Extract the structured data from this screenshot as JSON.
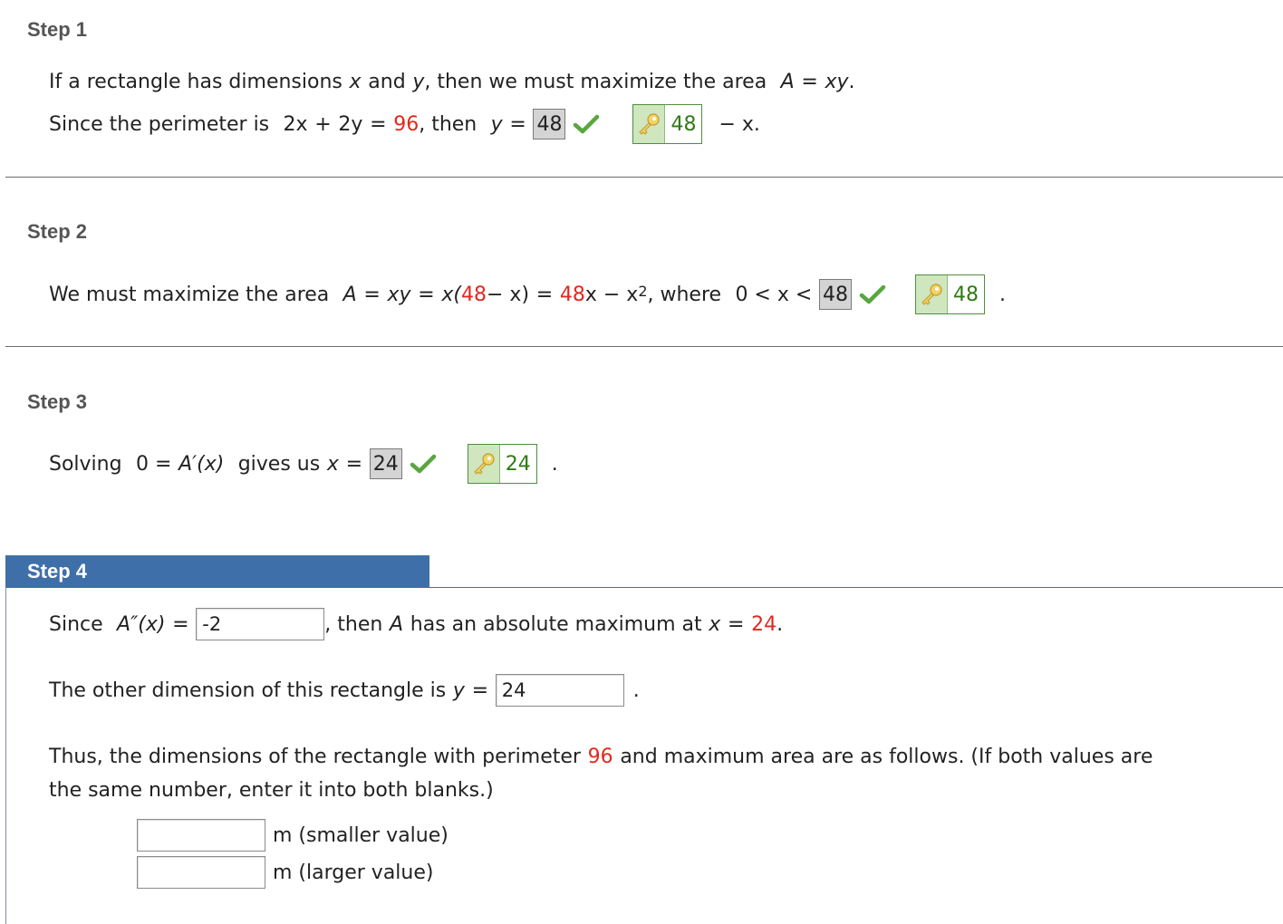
{
  "step1": {
    "title": "Step 1",
    "line1_a": "If a rectangle has dimensions",
    "line1_x": "x",
    "line1_and": "and",
    "line1_y": "y",
    "line1_b": ", then we must maximize the area",
    "line1_A": "A",
    "line1_eq": "=",
    "line1_xy": "xy",
    "line1_end": ".",
    "line2_a": "Since the perimeter is",
    "line2_2x": "2x",
    "line2_plus": "+",
    "line2_2y": "2y",
    "line2_eq": "=",
    "line2_96": "96",
    "line2_then": ", then",
    "line2_y": "y",
    "line2_eq2": "=",
    "given_value": "48",
    "answer_key_value": "48",
    "line2_tail": "− x."
  },
  "step2": {
    "title": "Step 2",
    "text_a": "We must maximize the area",
    "A": "A",
    "eq1": "=",
    "xy": "xy",
    "eq2": "=",
    "x_open": "x(",
    "n48a": "48",
    "minus_x_close": " − x)",
    "eq3": "=",
    "n48b": "48",
    "x_minus": "x − x",
    "sup2": "2",
    "where": ", where",
    "range": "0 < x <",
    "given_value": "48",
    "answer_key_value": "48",
    "end": "."
  },
  "step3": {
    "title": "Step 3",
    "text_a": "Solving",
    "eq0": "0 =",
    "Aprime": "A′(x)",
    "gives": "gives us",
    "x": "x",
    "eq": "=",
    "given_value": "24",
    "answer_key_value": "24",
    "end": "."
  },
  "step4": {
    "title": "Step 4",
    "since": "Since",
    "A2": "A″(x)",
    "eq": "=",
    "second_deriv_input": "-2",
    "then_a": ", then",
    "then_A": "A",
    "then_b": "has an absolute maximum at",
    "then_x": "x",
    "then_eq": "=",
    "then_24": "24",
    "then_end": ".",
    "other_dim_text": "The other dimension of this rectangle is",
    "other_y": "y",
    "other_eq": "=",
    "other_input": "24",
    "other_end": ".",
    "thus_a": "Thus, the dimensions of the rectangle with perimeter",
    "thus_96": "96",
    "thus_b": "and maximum area are as follows. (If both values are",
    "thus_c": "the same number, enter it into both blanks.)",
    "smaller_value": "",
    "smaller_label": "m (smaller value)",
    "larger_value": "",
    "larger_label": "m (larger value)"
  },
  "colors": {
    "step4_bar": "#3f6fa8",
    "red_number": "#e2281f",
    "key_green": "#2f7a15",
    "check_green": "#5aa640"
  }
}
